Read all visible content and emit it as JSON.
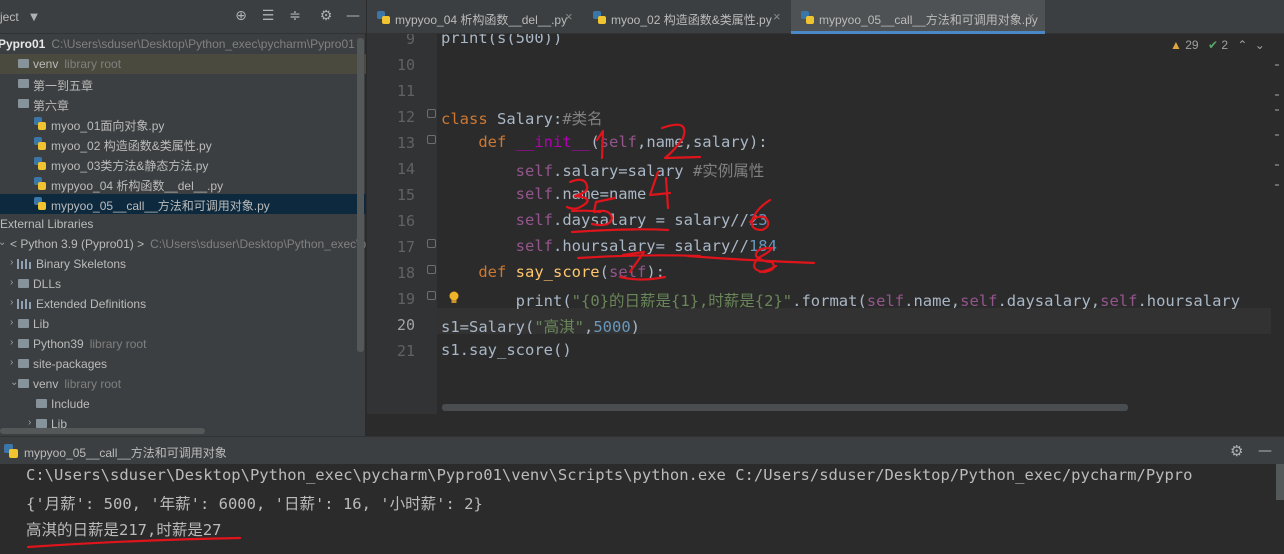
{
  "project_panel": {
    "title": "ject",
    "toolbar_icons": [
      "locate-icon",
      "expand-all-icon",
      "collapse-all-icon",
      "gear-icon",
      "hide-icon"
    ],
    "tree": [
      {
        "label": "Pypro01",
        "hint": "C:\\Users\\sduser\\Desktop\\Python_exec\\pycharm\\Pypro01",
        "indent": 0,
        "type": "root",
        "bold": true
      },
      {
        "label": "venv",
        "hint": "library root",
        "indent": 1,
        "type": "folder",
        "hl": true
      },
      {
        "label": "第一到五章",
        "hint": "",
        "indent": 1,
        "type": "folder"
      },
      {
        "label": "第六章",
        "hint": "",
        "indent": 1,
        "type": "folder"
      },
      {
        "label": "myoo_01面向对象.py",
        "hint": "",
        "indent": 2,
        "type": "py"
      },
      {
        "label": "myoo_02 构造函数&类属性.py",
        "hint": "",
        "indent": 2,
        "type": "py"
      },
      {
        "label": "myoo_03类方法&静态方法.py",
        "hint": "",
        "indent": 2,
        "type": "py"
      },
      {
        "label": "mypyoo_04 析构函数__del__.py",
        "hint": "",
        "indent": 2,
        "type": "py"
      },
      {
        "label": "mypyoo_05__call__方法和可调用对象.py",
        "hint": "",
        "indent": 2,
        "type": "py",
        "selected": true
      },
      {
        "label": "External Libraries",
        "hint": "",
        "indent": 0,
        "type": "plain"
      },
      {
        "label": "< Python 3.9 (Pypro01) >",
        "hint": "C:\\Users\\sduser\\Desktop\\Python_exec\\pycharm\\Pypro01",
        "indent": 0,
        "type": "plain",
        "arrow": "down"
      },
      {
        "label": "Binary Skeletons",
        "hint": "",
        "indent": 1,
        "type": "lib",
        "arrow": "right"
      },
      {
        "label": "DLLs",
        "hint": "",
        "indent": 1,
        "type": "folder",
        "arrow": "right"
      },
      {
        "label": "Extended Definitions",
        "hint": "",
        "indent": 1,
        "type": "lib",
        "arrow": "right"
      },
      {
        "label": "Lib",
        "hint": "",
        "indent": 1,
        "type": "folder",
        "arrow": "right"
      },
      {
        "label": "Python39",
        "hint": "library root",
        "indent": 1,
        "type": "folder",
        "arrow": "right"
      },
      {
        "label": "site-packages",
        "hint": "",
        "indent": 1,
        "type": "folder",
        "arrow": "right"
      },
      {
        "label": "venv",
        "hint": "library root",
        "indent": 1,
        "type": "folder",
        "arrow": "down"
      },
      {
        "label": "Include",
        "hint": "",
        "indent": 2,
        "type": "folder"
      },
      {
        "label": "Lib",
        "hint": "",
        "indent": 2,
        "type": "folder",
        "arrow": "right"
      }
    ]
  },
  "tabs": [
    {
      "label": "mypyoo_04 析构函数__del__.py",
      "active": false
    },
    {
      "label": "myoo_02 构造函数&类属性.py",
      "active": false
    },
    {
      "label": "mypyoo_05__call__方法和可调用对象.py",
      "active": true
    }
  ],
  "editor": {
    "warnings": "29",
    "checks": "2",
    "current_line": "20",
    "line_numbers": [
      "9",
      "10",
      "11",
      "12",
      "13",
      "14",
      "15",
      "16",
      "17",
      "18",
      "19",
      "20",
      "21"
    ],
    "lines": [
      [
        [
          "p",
          "print(s(500))"
        ]
      ],
      [],
      [],
      [
        [
          "kw",
          "class "
        ],
        [
          "p",
          "Salary:"
        ],
        [
          "cm",
          "#类名"
        ]
      ],
      [
        [
          "p",
          "    "
        ],
        [
          "kw",
          "def "
        ],
        [
          "magic",
          "__init__"
        ],
        [
          "p",
          "("
        ],
        [
          "self",
          "self"
        ],
        [
          "p",
          ",name,salary):"
        ]
      ],
      [
        [
          "p",
          "        "
        ],
        [
          "self",
          "self"
        ],
        [
          "p",
          ".salary=salary "
        ],
        [
          "cm",
          "#实例属性"
        ]
      ],
      [
        [
          "p",
          "        "
        ],
        [
          "self",
          "self"
        ],
        [
          "p",
          ".name=name"
        ]
      ],
      [
        [
          "p",
          "        "
        ],
        [
          "self",
          "self"
        ],
        [
          "p",
          ".daysalary = salary//"
        ],
        [
          "num",
          "23"
        ]
      ],
      [
        [
          "p",
          "        "
        ],
        [
          "self",
          "self"
        ],
        [
          "p",
          ".hoursalary= salary//"
        ],
        [
          "num",
          "184"
        ]
      ],
      [
        [
          "p",
          "    "
        ],
        [
          "kw",
          "def "
        ],
        [
          "fn",
          "say_score"
        ],
        [
          "p",
          "("
        ],
        [
          "self",
          "self"
        ],
        [
          "p",
          "):"
        ]
      ],
      [
        [
          "p",
          "        print("
        ],
        [
          "str",
          "\"{0}的日薪是{1},时薪是{2}\""
        ],
        [
          "p",
          ".format("
        ],
        [
          "self",
          "self"
        ],
        [
          "p",
          ".name,"
        ],
        [
          "self",
          "self"
        ],
        [
          "p",
          ".daysalary,"
        ],
        [
          "self",
          "self"
        ],
        [
          "p",
          ".hoursalary"
        ]
      ],
      [
        [
          "p",
          "s1=Salary("
        ],
        [
          "str",
          "\"高淇\""
        ],
        [
          "p",
          ","
        ],
        [
          "num",
          "5000"
        ],
        [
          "p",
          ")"
        ]
      ],
      [
        [
          "p",
          "s1.say_score()"
        ]
      ]
    ]
  },
  "run_panel": {
    "title": "mypyoo_05__call__方法和可调用对象",
    "console": [
      "C:\\Users\\sduser\\Desktop\\Python_exec\\pycharm\\Pypro01\\venv\\Scripts\\python.exe C:/Users/sduser/Desktop/Python_exec/pycharm/Pypro",
      "{'月薪': 500, '年薪': 6000, '日薪': 16, '小时薪': 2}",
      "高淇的日薪是217,时薪是27"
    ]
  },
  "annotations": [
    "1",
    "2",
    "3",
    "4",
    "5",
    "6",
    "7",
    "8"
  ],
  "colors": {
    "keyword": "#cc7832",
    "function": "#ffc66d",
    "self": "#94558d",
    "number": "#6897bb",
    "string": "#6a8759",
    "comment": "#808080",
    "selection": "#0d293e",
    "pen": "#e0141b"
  }
}
